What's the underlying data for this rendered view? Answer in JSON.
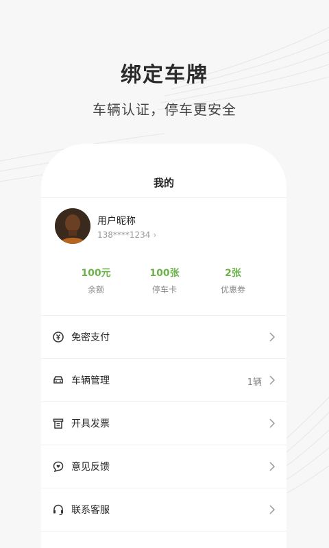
{
  "promo": {
    "headline": "绑定车牌",
    "subline": "车辆认证，停车更安全"
  },
  "screen": {
    "title": "我的",
    "user": {
      "nickname": "用户昵称",
      "phone": "138****1234"
    },
    "stats": [
      {
        "value": "100元",
        "label": "余额"
      },
      {
        "value": "100张",
        "label": "停车卡"
      },
      {
        "value": "2张",
        "label": "优惠券"
      }
    ],
    "menu": [
      {
        "label": "免密支付",
        "extra": "",
        "icon": "pay-icon"
      },
      {
        "label": "车辆管理",
        "extra": "1辆",
        "icon": "car-icon"
      },
      {
        "label": "开具发票",
        "extra": "",
        "icon": "invoice-icon"
      },
      {
        "label": "意见反馈",
        "extra": "",
        "icon": "feedback-icon"
      },
      {
        "label": "联系客服",
        "extra": "",
        "icon": "headset-icon"
      }
    ]
  },
  "colors": {
    "accent_green": "#6bb24a",
    "background": "#f7f7f7",
    "card": "#ffffff"
  }
}
